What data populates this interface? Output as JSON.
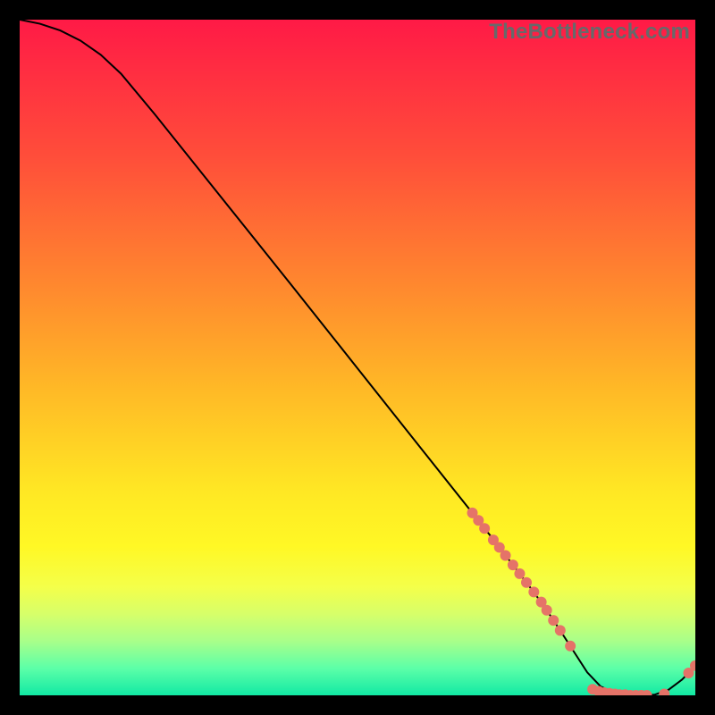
{
  "watermark": "TheBottleneck.com",
  "chart_data": {
    "type": "line",
    "title": "",
    "xlabel": "",
    "ylabel": "",
    "xlim": [
      0,
      100
    ],
    "ylim": [
      0,
      100
    ],
    "grid": false,
    "curve_color": "#000000",
    "dot_color": "#e57368",
    "gradient_stops": [
      {
        "offset": 0,
        "color": "#ff1a46"
      },
      {
        "offset": 20,
        "color": "#ff4d3a"
      },
      {
        "offset": 40,
        "color": "#ff8a2e"
      },
      {
        "offset": 55,
        "color": "#ffba26"
      },
      {
        "offset": 70,
        "color": "#ffe824"
      },
      {
        "offset": 78,
        "color": "#fff825"
      },
      {
        "offset": 84,
        "color": "#f4ff4a"
      },
      {
        "offset": 88,
        "color": "#d6ff6a"
      },
      {
        "offset": 92,
        "color": "#a8ff8a"
      },
      {
        "offset": 96,
        "color": "#5cffa8"
      },
      {
        "offset": 100,
        "color": "#12e9a4"
      }
    ],
    "series": [
      {
        "name": "curve",
        "x": [
          0,
          3,
          6,
          9,
          12,
          15,
          20,
          30,
          40,
          50,
          60,
          67,
          70,
          73,
          76,
          78,
          80,
          82,
          84,
          86,
          88,
          90,
          92,
          94,
          96,
          98,
          99,
          100
        ],
        "y": [
          100.0,
          99.4,
          98.4,
          96.9,
          94.8,
          92.0,
          86.0,
          73.5,
          61.0,
          48.4,
          35.8,
          27.0,
          23.2,
          19.3,
          15.4,
          12.6,
          9.6,
          6.5,
          3.4,
          1.3,
          0.4,
          0.1,
          0.0,
          0.1,
          0.8,
          2.3,
          3.3,
          4.4
        ]
      }
    ],
    "dots": [
      {
        "x": 67.0,
        "y": 27.0
      },
      {
        "x": 67.9,
        "y": 25.9
      },
      {
        "x": 68.8,
        "y": 24.7
      },
      {
        "x": 70.1,
        "y": 23.0
      },
      {
        "x": 71.0,
        "y": 21.9
      },
      {
        "x": 71.9,
        "y": 20.7
      },
      {
        "x": 73.0,
        "y": 19.3
      },
      {
        "x": 74.0,
        "y": 18.0
      },
      {
        "x": 75.0,
        "y": 16.7
      },
      {
        "x": 76.1,
        "y": 15.3
      },
      {
        "x": 77.2,
        "y": 13.8
      },
      {
        "x": 78.0,
        "y": 12.6
      },
      {
        "x": 79.0,
        "y": 11.1
      },
      {
        "x": 80.0,
        "y": 9.6
      },
      {
        "x": 81.5,
        "y": 7.3
      },
      {
        "x": 84.8,
        "y": 0.9
      },
      {
        "x": 85.7,
        "y": 0.6
      },
      {
        "x": 86.5,
        "y": 0.4
      },
      {
        "x": 87.3,
        "y": 0.3
      },
      {
        "x": 88.1,
        "y": 0.2
      },
      {
        "x": 88.8,
        "y": 0.1
      },
      {
        "x": 89.6,
        "y": 0.1
      },
      {
        "x": 90.4,
        "y": 0.0
      },
      {
        "x": 91.2,
        "y": 0.0
      },
      {
        "x": 92.0,
        "y": 0.0
      },
      {
        "x": 92.8,
        "y": 0.0
      },
      {
        "x": 95.4,
        "y": 0.2
      },
      {
        "x": 99.0,
        "y": 3.3
      },
      {
        "x": 100.0,
        "y": 4.4
      }
    ]
  }
}
